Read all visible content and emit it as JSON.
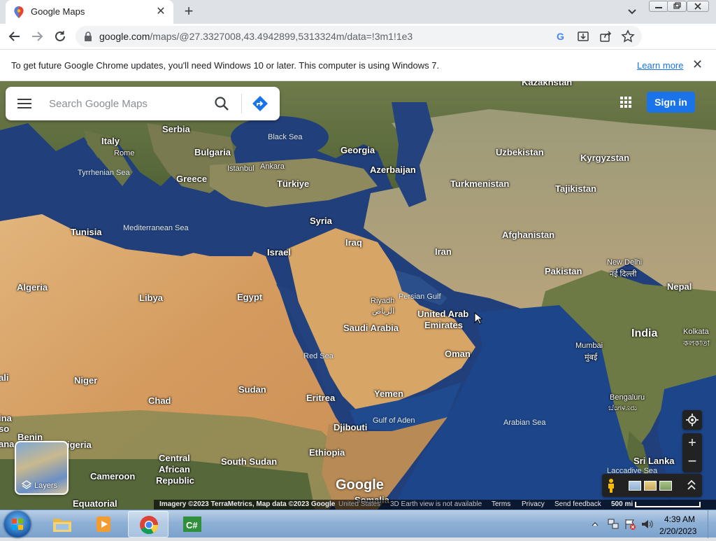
{
  "tab": {
    "title": "Google Maps",
    "favicon": "google-maps-pin-icon"
  },
  "toolbar": {
    "url_host": "google.com",
    "url_path": "/maps/@27.3327008,43.4942899,5313324m/data=!3m1!1e3"
  },
  "infobar": {
    "message": "To get future Google Chrome updates, you'll need Windows 10 or later. This computer is using Windows 7.",
    "learn_more": "Learn more"
  },
  "maps": {
    "search_placeholder": "Search Google Maps",
    "signin": "Sign in",
    "layers": "Layers",
    "logo": "Google",
    "labels": {
      "kazakhstan": "Kazakhstan",
      "serbia": "Serbia",
      "italy": "Italy",
      "rome": "Rome",
      "bulgaria": "Bulgaria",
      "black_sea": "Black Sea",
      "georgia": "Georgia",
      "uzbekistan": "Uzbekistan",
      "kyrgyzstan": "Kyrgyzstan",
      "tyrrhenian_sea": "Tyrrhenian Sea",
      "istanbul": "Istanbul",
      "ankara": "Ankara",
      "azerbaijan": "Azerbaijan",
      "greece": "Greece",
      "turkiye": "Türkiye",
      "turkmenistan": "Turkmenistan",
      "tajikistan": "Tajikistan",
      "tunisia": "Tunisia",
      "mediterranean_sea": "Mediterranean Sea",
      "syria": "Syria",
      "afghanistan": "Afghanistan",
      "iraq": "Iraq",
      "israel": "Israel",
      "iran": "Iran",
      "new_delhi": "New Delhi",
      "new_delhi_hindi": "नई दिल्ली",
      "pakistan": "Pakistan",
      "algeria": "Algeria",
      "nepal": "Nepal",
      "libya": "Libya",
      "egypt": "Egypt",
      "persian_gulf": "Persian Gulf",
      "riyadh": "Riyadh",
      "riyadh_arabic": "الرياض",
      "uae_1": "United Arab",
      "uae_2": "Emirates",
      "saudi_arabia": "Saudi Arabia",
      "india": "India",
      "kolkata": "Kolkata",
      "kolkata_bengali": "কলকাতা",
      "mumbai": "Mumbai",
      "mumbai_marathi": "मुंबई",
      "oman": "Oman",
      "red_sea": "Red Sea",
      "niger": "Niger",
      "sudan": "Sudan",
      "yemen": "Yemen",
      "chad": "Chad",
      "eritrea": "Eritrea",
      "bengaluru": "Bengaluru",
      "bengaluru_kannada": "ಬೆಂಗಳೂರು",
      "gulf_of_aden": "Gulf of Aden",
      "arabian_sea": "Arabian Sea",
      "djibouti": "Djibouti",
      "benin": "Benin",
      "nigeria": "igeria",
      "ethiopia": "Ethiopia",
      "central_african_1": "Central",
      "central_african_2": "African",
      "central_african_3": "Republic",
      "south_sudan": "South Sudan",
      "sri_lanka": "Sri Lanka",
      "cameroon": "Cameroon",
      "laccadive_sea": "Laccadive Sea",
      "equatorial": "Equatorial",
      "somalia": "Somalia",
      "left_edge_1": "ali",
      "left_edge_2": "ina",
      "left_edge_3": "so",
      "left_edge_4": "ana"
    },
    "attribution": {
      "imagery": "Imagery ©2023 TerraMetrics, Map data ©2023 Google",
      "country": "United States",
      "earth_view": "3D Earth view is not available",
      "terms": "Terms",
      "privacy": "Privacy",
      "feedback": "Send feedback",
      "scale": "500 mi"
    }
  },
  "taskbar": {
    "time": "4:39 AM",
    "date": "2/20/2023",
    "apps": [
      "Windows Explorer",
      "Windows Media Player",
      "Google Chrome",
      "Visual C#"
    ]
  },
  "colors": {
    "accent": "#1a73e8",
    "sea": "#1f4e8c",
    "desert": "#d9a66a"
  }
}
